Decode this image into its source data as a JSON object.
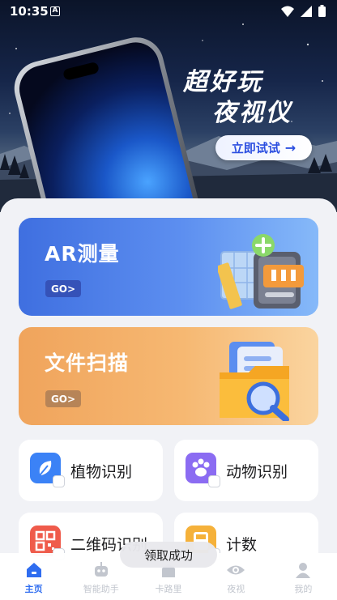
{
  "status_bar": {
    "time": "10:35",
    "notification_icon": "A"
  },
  "hero": {
    "title_line1": "超好玩",
    "title_line2": "夜视仪",
    "try_button": "立即试试",
    "try_arrow": "→"
  },
  "cards": {
    "ar": {
      "title": "AR测量",
      "go": "GO>"
    },
    "file": {
      "title": "文件扫描",
      "go": "GO>"
    }
  },
  "tools": [
    {
      "label": "植物识别",
      "icon": "leaf-icon",
      "color": "#3b82f6"
    },
    {
      "label": "动物识别",
      "icon": "paw-icon",
      "color": "#8b6cf2"
    },
    {
      "label": "二维码识别",
      "icon": "qr-code-icon",
      "color": "#ef5b4b"
    },
    {
      "label": "计数",
      "icon": "counter-icon",
      "color": "#f5b13a"
    }
  ],
  "toast": "领取成功",
  "nav": [
    {
      "label": "主页",
      "icon": "home-icon",
      "active": true
    },
    {
      "label": "智能助手",
      "icon": "robot-icon",
      "active": false
    },
    {
      "label": "卡路里",
      "icon": "calorie-icon",
      "active": false
    },
    {
      "label": "夜视",
      "icon": "eye-icon",
      "active": false
    },
    {
      "label": "我的",
      "icon": "profile-icon",
      "active": false
    }
  ],
  "colors": {
    "accent": "#2f6df0",
    "inactive": "#c2c6ce",
    "ar_card": "#4f7de8",
    "file_card": "#f3ad66"
  }
}
